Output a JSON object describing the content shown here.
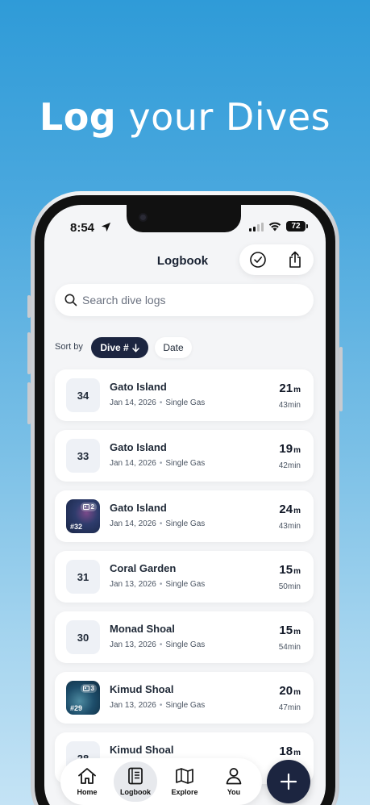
{
  "headline": {
    "bold": "Log",
    "rest": " your Dives"
  },
  "status": {
    "time": "8:54",
    "battery": "72"
  },
  "header": {
    "title": "Logbook"
  },
  "search": {
    "placeholder": "Search dive logs"
  },
  "sort": {
    "label": "Sort by",
    "active": "Dive #",
    "other": "Date"
  },
  "dives": [
    {
      "number": "34",
      "site": "Gato Island",
      "date": "Jan 14, 2026",
      "gas": "Single Gas",
      "depth": "21",
      "unit": "m",
      "duration": "43min"
    },
    {
      "number": "33",
      "site": "Gato Island",
      "date": "Jan 14, 2026",
      "gas": "Single Gas",
      "depth": "19",
      "unit": "m",
      "duration": "42min"
    },
    {
      "number": "#32",
      "photos": "2",
      "site": "Gato Island",
      "date": "Jan 14, 2026",
      "gas": "Single Gas",
      "depth": "24",
      "unit": "m",
      "duration": "43min"
    },
    {
      "number": "31",
      "site": "Coral Garden",
      "date": "Jan 13, 2026",
      "gas": "Single Gas",
      "depth": "15",
      "unit": "m",
      "duration": "50min"
    },
    {
      "number": "30",
      "site": "Monad Shoal",
      "date": "Jan 13, 2026",
      "gas": "Single Gas",
      "depth": "15",
      "unit": "m",
      "duration": "54min"
    },
    {
      "number": "#29",
      "photos": "3",
      "site": "Kimud Shoal",
      "date": "Jan 13, 2026",
      "gas": "Single Gas",
      "depth": "20",
      "unit": "m",
      "duration": "47min"
    },
    {
      "number": "28",
      "site": "Kimud Shoal",
      "date": "",
      "gas": "",
      "depth": "18",
      "unit": "m",
      "duration": ""
    }
  ],
  "tabs": [
    {
      "label": "Home",
      "icon": "home-icon"
    },
    {
      "label": "Logbook",
      "icon": "logbook-icon"
    },
    {
      "label": "Explore",
      "icon": "map-icon"
    },
    {
      "label": "You",
      "icon": "person-icon"
    }
  ],
  "colors": {
    "accent": "#1c2540",
    "background_top": "#2f9bd8",
    "background_bottom": "#c4e3f5"
  }
}
